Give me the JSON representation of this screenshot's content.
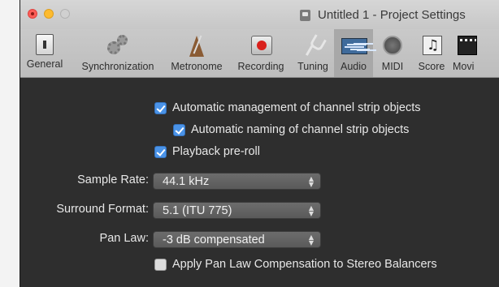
{
  "window": {
    "title": "Untitled 1 - Project Settings"
  },
  "toolbar": {
    "items": [
      {
        "label": "General",
        "icon": "general-icon"
      },
      {
        "label": "Synchronization",
        "icon": "gears-icon"
      },
      {
        "label": "Metronome",
        "icon": "metronome-icon"
      },
      {
        "label": "Recording",
        "icon": "record-icon"
      },
      {
        "label": "Tuning",
        "icon": "tuning-fork-icon"
      },
      {
        "label": "Audio",
        "icon": "waveform-icon",
        "active": true
      },
      {
        "label": "MIDI",
        "icon": "midi-port-icon"
      },
      {
        "label": "Score",
        "icon": "score-icon"
      },
      {
        "label": "Movi",
        "icon": "movie-icon"
      }
    ]
  },
  "audio": {
    "auto_manage": {
      "label": "Automatic management of channel strip objects",
      "checked": true
    },
    "auto_naming": {
      "label": "Automatic naming of channel strip objects",
      "checked": true
    },
    "preroll": {
      "label": "Playback pre-roll",
      "checked": true
    },
    "sample_rate": {
      "label": "Sample Rate:",
      "value": "44.1 kHz"
    },
    "surround_format": {
      "label": "Surround Format:",
      "value": "5.1 (ITU 775)"
    },
    "pan_law": {
      "label": "Pan Law:",
      "value": "-3 dB compensated"
    },
    "pan_comp": {
      "label": "Apply Pan Law Compensation to Stereo Balancers",
      "checked": false
    }
  },
  "colors": {
    "accent": "#4a93e8",
    "panel": "#2e2e2e"
  }
}
